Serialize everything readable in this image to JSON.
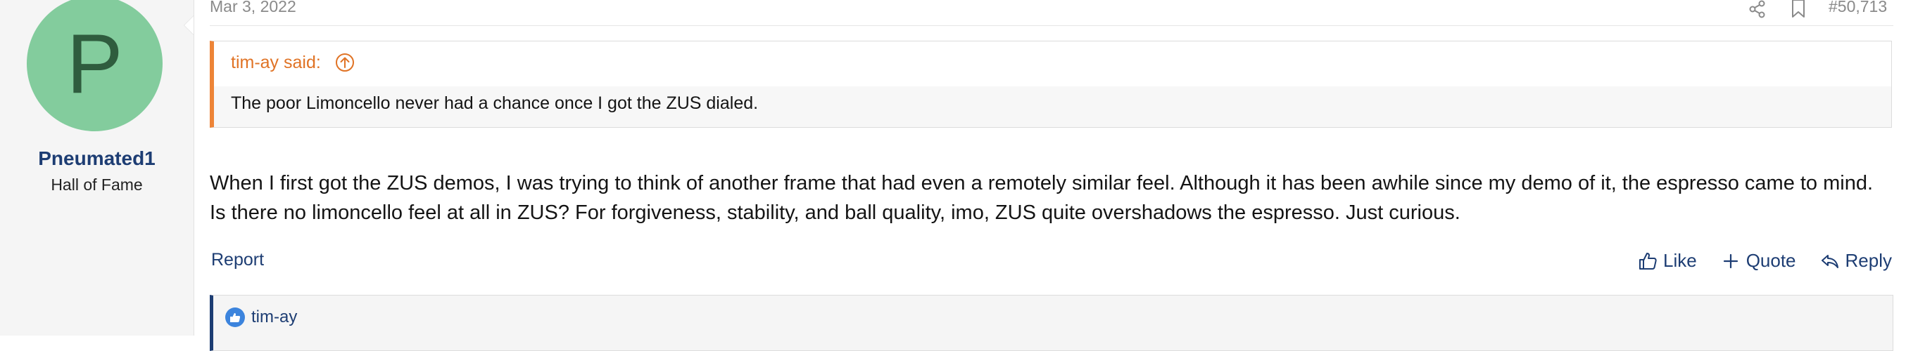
{
  "user": {
    "avatar_letter": "P",
    "avatar_color": "#83cc9d",
    "username": "Pneumated1",
    "title": "Hall of Fame"
  },
  "post": {
    "date": "Mar 3, 2022",
    "number": "#50,713",
    "icons": [
      "share-icon",
      "bookmark-icon"
    ]
  },
  "quote": {
    "author": "tim-ay said:",
    "body": "The poor Limoncello never had a chance once I got the ZUS dialed.",
    "accent_color": "#ed8437"
  },
  "message": {
    "text": "When I first got the ZUS demos, I was trying to think of another frame that had even a remotely similar feel. Although it has been awhile since my demo of it, the espresso came to mind. Is there no limoncello feel at all in ZUS? For forgiveness, stability, and ball quality, imo, ZUS quite overshadows the espresso. Just curious."
  },
  "actions": {
    "report": "Report",
    "like": "Like",
    "quote": "Quote",
    "reply": "Reply"
  },
  "reactions": {
    "users": "tim-ay",
    "icon": "like-reaction-icon"
  }
}
